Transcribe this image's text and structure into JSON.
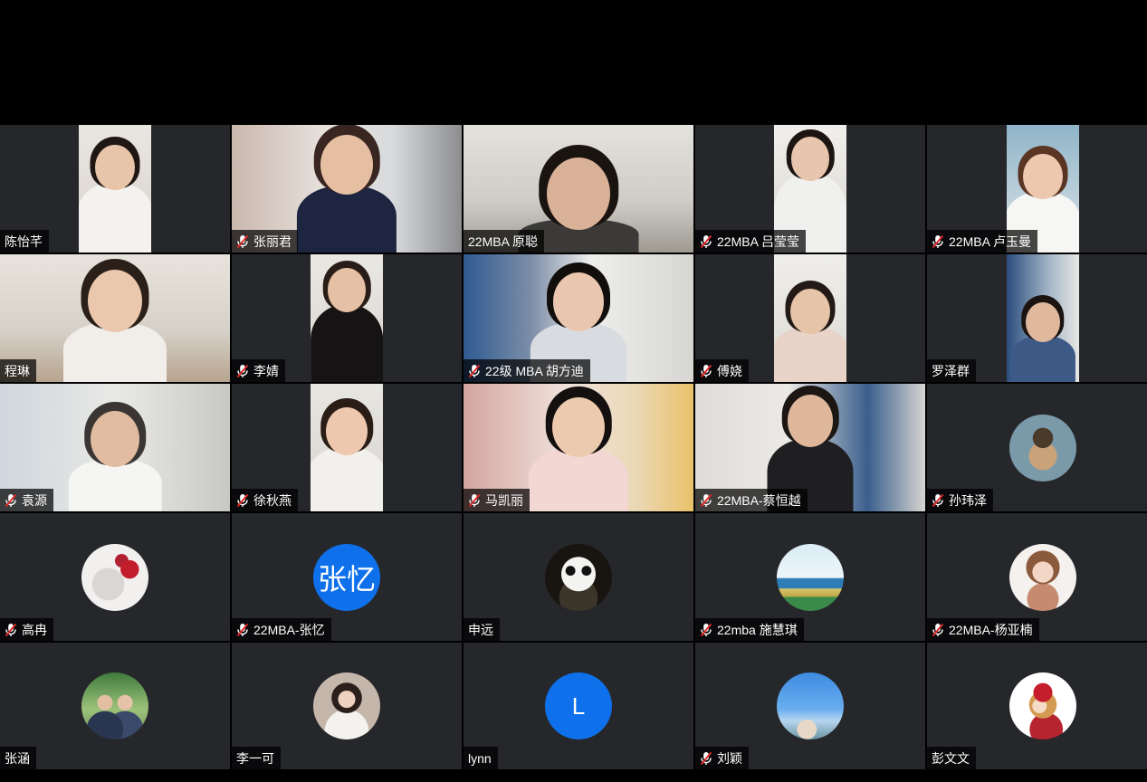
{
  "colors": {
    "tile_bg": "#26272b",
    "window_bg": "#000000",
    "label_bg": "rgba(0,0,0,0.72)",
    "mute_red": "#e02828",
    "initials_blue": "#0e71eb"
  },
  "participants": [
    {
      "name": "陈怡芊",
      "muted": false,
      "kind": "video"
    },
    {
      "name": "张丽君",
      "muted": true,
      "kind": "video"
    },
    {
      "name": "22MBA 原聪",
      "muted": false,
      "kind": "video"
    },
    {
      "name": "22MBA 吕莹莹",
      "muted": true,
      "kind": "video"
    },
    {
      "name": "22MBA 卢玉曼",
      "muted": true,
      "kind": "video"
    },
    {
      "name": "程琳",
      "muted": false,
      "kind": "video"
    },
    {
      "name": "李婧",
      "muted": true,
      "kind": "video"
    },
    {
      "name": "22级 MBA 胡方迪",
      "muted": true,
      "kind": "video"
    },
    {
      "name": "傅娆",
      "muted": true,
      "kind": "video"
    },
    {
      "name": "罗泽群",
      "muted": false,
      "kind": "video"
    },
    {
      "name": "袁源",
      "muted": true,
      "kind": "video"
    },
    {
      "name": "徐秋燕",
      "muted": true,
      "kind": "video"
    },
    {
      "name": "马凯丽",
      "muted": true,
      "kind": "video"
    },
    {
      "name": "22MBA-蔡恒越",
      "muted": true,
      "kind": "video"
    },
    {
      "name": "孙玮泽",
      "muted": true,
      "kind": "avatar",
      "avatar_icon": "pixel-hat-avatar"
    },
    {
      "name": "高冉",
      "muted": true,
      "kind": "avatar",
      "avatar_icon": "cat-avatar"
    },
    {
      "name": "22MBA-张忆",
      "muted": true,
      "kind": "initials",
      "initials": "张忆"
    },
    {
      "name": "申远",
      "muted": false,
      "kind": "avatar",
      "avatar_icon": "panda-avatar"
    },
    {
      "name": "22mba 施慧琪",
      "muted": true,
      "kind": "avatar",
      "avatar_icon": "sea-avatar"
    },
    {
      "name": "22MBA-杨亚楠",
      "muted": true,
      "kind": "avatar",
      "avatar_icon": "cartoon-girl-avatar"
    },
    {
      "name": "张涵",
      "muted": false,
      "kind": "avatar",
      "avatar_icon": "couple-photo-avatar"
    },
    {
      "name": "李一可",
      "muted": false,
      "kind": "avatar",
      "avatar_icon": "portrait-avatar"
    },
    {
      "name": "lynn",
      "muted": false,
      "kind": "initials",
      "initials": "L"
    },
    {
      "name": "刘颖",
      "muted": true,
      "kind": "avatar",
      "avatar_icon": "sky-avatar"
    },
    {
      "name": "彭文文",
      "muted": false,
      "kind": "avatar",
      "avatar_icon": "cartoon-red-hat-avatar"
    }
  ]
}
